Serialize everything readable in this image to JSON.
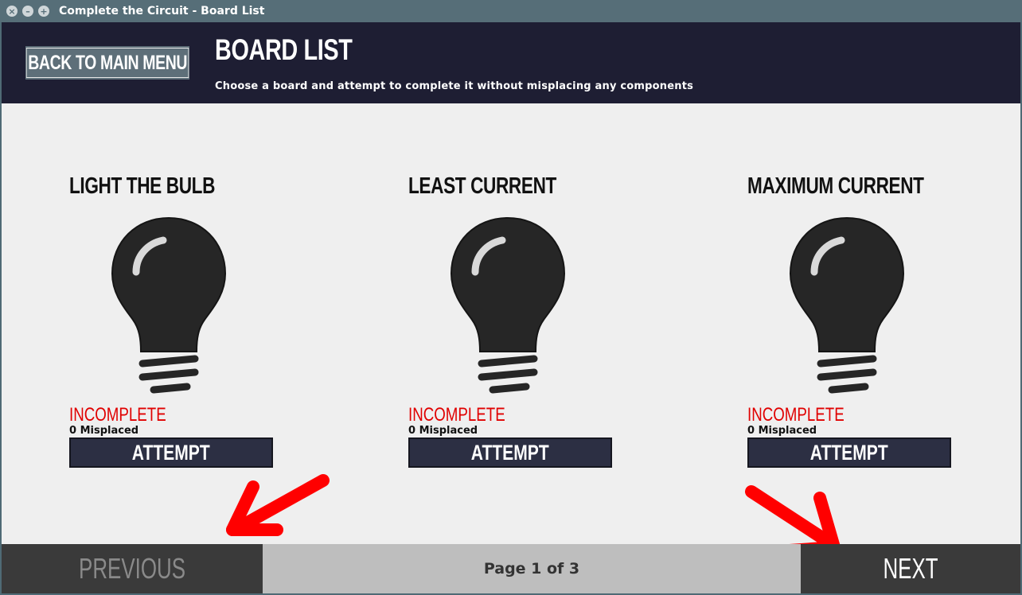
{
  "window": {
    "title": "Complete the Circuit - Board List",
    "buttons": [
      "close-icon",
      "minimize-icon",
      "maximize-icon"
    ]
  },
  "header": {
    "back_label": "BACK TO MAIN MENU",
    "title": "BOARD LIST",
    "subtitle": "Choose a board and attempt to complete it without misplacing any components"
  },
  "boards": [
    {
      "title": "LIGHT THE BULB",
      "status": "INCOMPLETE",
      "misplaced": "0 Misplaced",
      "action": "ATTEMPT",
      "icon": "lightbulb-icon"
    },
    {
      "title": "LEAST CURRENT",
      "status": "INCOMPLETE",
      "misplaced": "0 Misplaced",
      "action": "ATTEMPT",
      "icon": "lightbulb-icon"
    },
    {
      "title": "MAXIMUM CURRENT",
      "status": "INCOMPLETE",
      "misplaced": "0 Misplaced",
      "action": "ATTEMPT",
      "icon": "lightbulb-icon"
    }
  ],
  "footer": {
    "prev_label": "PREVIOUS",
    "page_label": "Page 1 of 3",
    "next_label": "NEXT"
  },
  "colors": {
    "header_bg": "#1e1e33",
    "status_incomplete": "#e00000",
    "arrow": "#ff0000",
    "button_bg": "#2c2f43"
  }
}
